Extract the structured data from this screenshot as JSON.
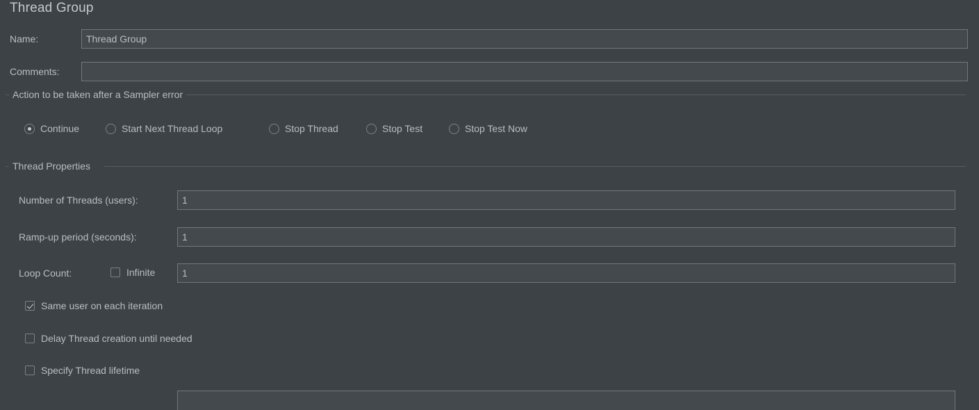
{
  "panel": {
    "title": "Thread Group",
    "colors": {
      "background": "#3c4245",
      "text": "#b9bec1",
      "field_background": "#43494c",
      "field_border": "#71797c",
      "rule": "#565d60"
    }
  },
  "fields": {
    "name": {
      "label": "Name:",
      "value": "Thread Group",
      "placeholder": ""
    },
    "comments": {
      "label": "Comments:",
      "value": "",
      "placeholder": ""
    }
  },
  "sampler_error_group": {
    "title": "Action to be taken after a Sampler error",
    "options": [
      {
        "label": "Continue",
        "selected": true
      },
      {
        "label": "Start Next Thread Loop",
        "selected": false
      },
      {
        "label": "Stop Thread",
        "selected": false
      },
      {
        "label": "Stop Test",
        "selected": false
      },
      {
        "label": "Stop Test Now",
        "selected": false
      }
    ]
  },
  "thread_properties_group": {
    "title": "Thread Properties",
    "number_of_threads": {
      "label": "Number of Threads (users):",
      "value": "1",
      "placeholder": ""
    },
    "ramp_up_period": {
      "label": "Ramp-up period (seconds):",
      "value": "1",
      "placeholder": ""
    },
    "loop_count": {
      "label": "Loop Count:",
      "infinite_label": "Infinite",
      "infinite_checked": false,
      "value": "1",
      "placeholder": ""
    },
    "checkboxes": [
      {
        "label": "Same user on each iteration",
        "checked": true
      },
      {
        "label": "Delay Thread creation until needed",
        "checked": false
      },
      {
        "label": "Specify Thread lifetime",
        "checked": false
      }
    ]
  }
}
